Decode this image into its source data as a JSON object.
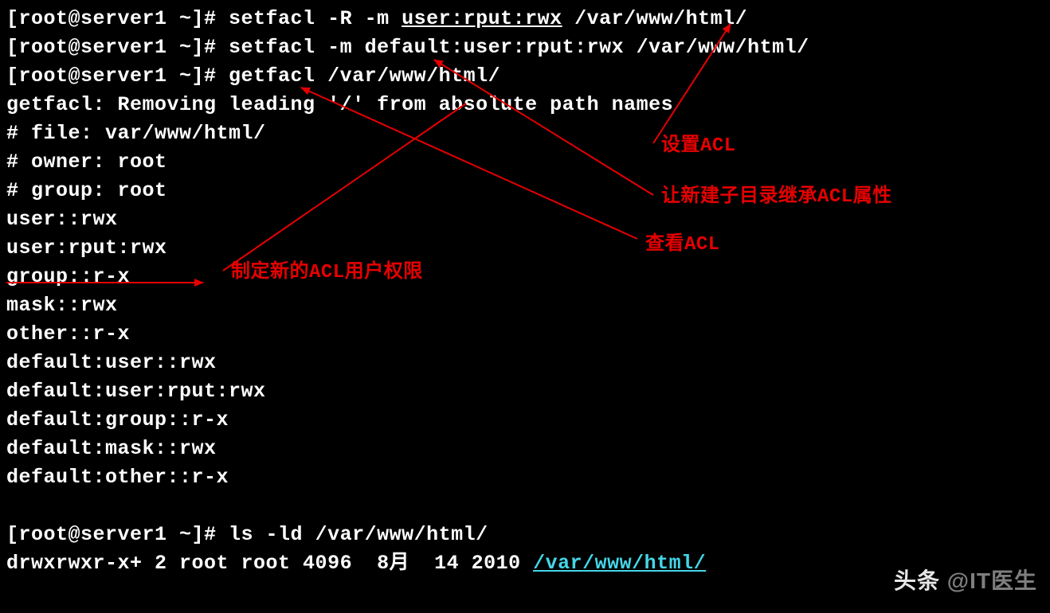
{
  "prompt": "[root@server1 ~]# ",
  "commands": {
    "c1_a": "setfacl -R -m ",
    "c1_u": "user:rput:rwx",
    "c1_b": " /var/www/html/",
    "c2_a": "setfacl -m default:user:rput:rwx /var/www/html/",
    "c3_a": "getfacl /var/www/html/"
  },
  "output_lines": {
    "o1": "getfacl: Removing leading '/' from absolute path names",
    "o2": "# file: var/www/html/",
    "o3": "# owner: root",
    "o4": "# group: root",
    "o5": "user::rwx",
    "o6": "user:rput:rwx",
    "o7": "group::r-x",
    "o8": "mask::rwx",
    "o9": "other::r-x",
    "o10": "default:user::rwx",
    "o11": "default:user:rput:rwx",
    "o12": "default:group::r-x",
    "o13": "default:mask::rwx",
    "o14": "default:other::r-x"
  },
  "ls_cmd": "ls -ld /var/www/html/",
  "ls_out_a": "drwxrwxr-x+ 2 root root 4096  8月  14 2010 ",
  "ls_out_b": "/var/www/html/",
  "annotations": {
    "a1": "设置ACL",
    "a2": "让新建子目录继承ACL属性",
    "a3": "查看ACL",
    "a4": "制定新的ACL用户权限"
  },
  "watermark_a": "头条",
  "watermark_b": " @IT医生",
  "colors": {
    "annotation": "#e60000",
    "link": "#44d6e8",
    "bg": "#000000",
    "fg": "#ffffff"
  }
}
